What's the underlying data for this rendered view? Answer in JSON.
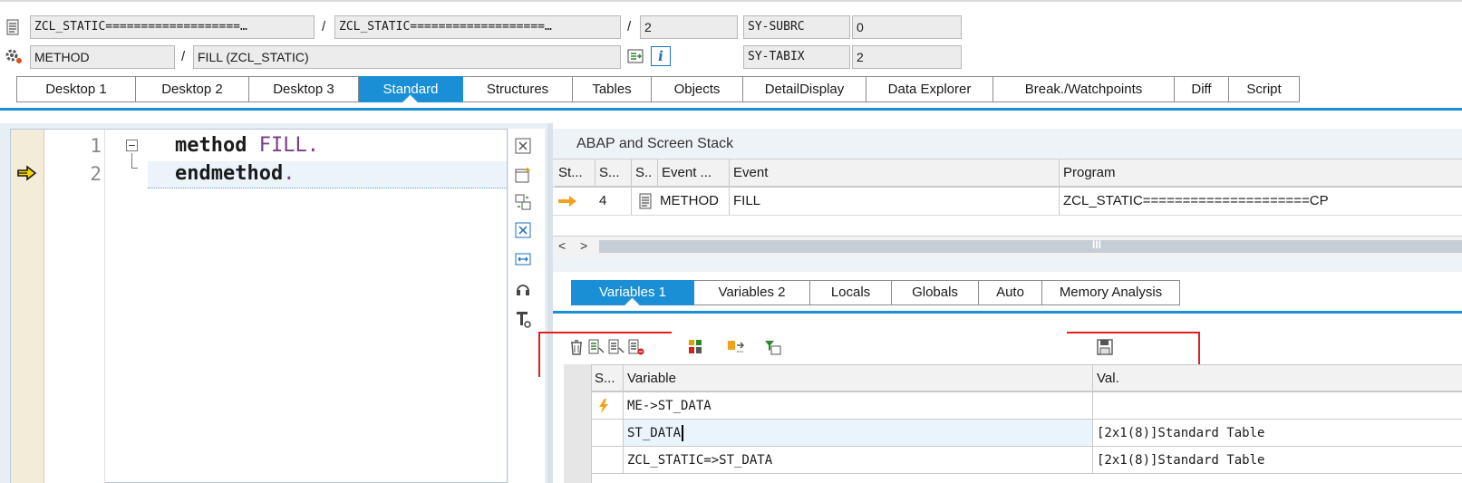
{
  "header": {
    "row1": {
      "include": "ZCL_STATIC===================…",
      "program": "ZCL_STATIC===================…",
      "line": "2",
      "sysubrc_label": "SY-SUBRC",
      "sysubrc_value": "0"
    },
    "row2": {
      "event_type": "METHOD",
      "event": "FILL (ZCL_STATIC)",
      "sytabix_label": "SY-TABIX",
      "sytabix_value": "2"
    },
    "separator": "/"
  },
  "tabs": [
    "Desktop 1",
    "Desktop 2",
    "Desktop 3",
    "Standard",
    "Structures",
    "Tables",
    "Objects",
    "DetailDisplay",
    "Data Explorer",
    "Break./Watchpoints",
    "Diff",
    "Script"
  ],
  "active_tab": "Standard",
  "source": {
    "lines": [
      {
        "num": "1",
        "keyword": "method",
        "rest": "FILL",
        "dot": "."
      },
      {
        "num": "2",
        "keyword": "endmethod",
        "rest": "",
        "dot": "."
      }
    ]
  },
  "stack": {
    "title": "ABAP and Screen Stack",
    "headers": [
      "St...",
      "S...",
      "S..",
      "Event ...",
      "Event",
      "Program"
    ],
    "row": {
      "depth": "4",
      "event_type": "METHOD",
      "event": "FILL",
      "program": "ZCL_STATIC=====================CP"
    }
  },
  "var_tabs": [
    "Variables 1",
    "Variables 2",
    "Locals",
    "Globals",
    "Auto",
    "Memory Analysis"
  ],
  "active_var_tab": "Variables 1",
  "variables": {
    "headers": [
      "S...",
      "Variable",
      "Val."
    ],
    "rows": [
      {
        "variable": "ME->ST_DATA",
        "value": ""
      },
      {
        "variable": "ST_DATA",
        "value": "[2x1(8)]Standard Table"
      },
      {
        "variable": "ZCL_STATIC=>ST_DATA",
        "value": "[2x1(8)]Standard Table"
      }
    ]
  },
  "colors": {
    "accent": "#1a8fd6",
    "keyword": "#1a1a1a",
    "identifier": "#7a3d8c",
    "annotation": "#e02020"
  }
}
